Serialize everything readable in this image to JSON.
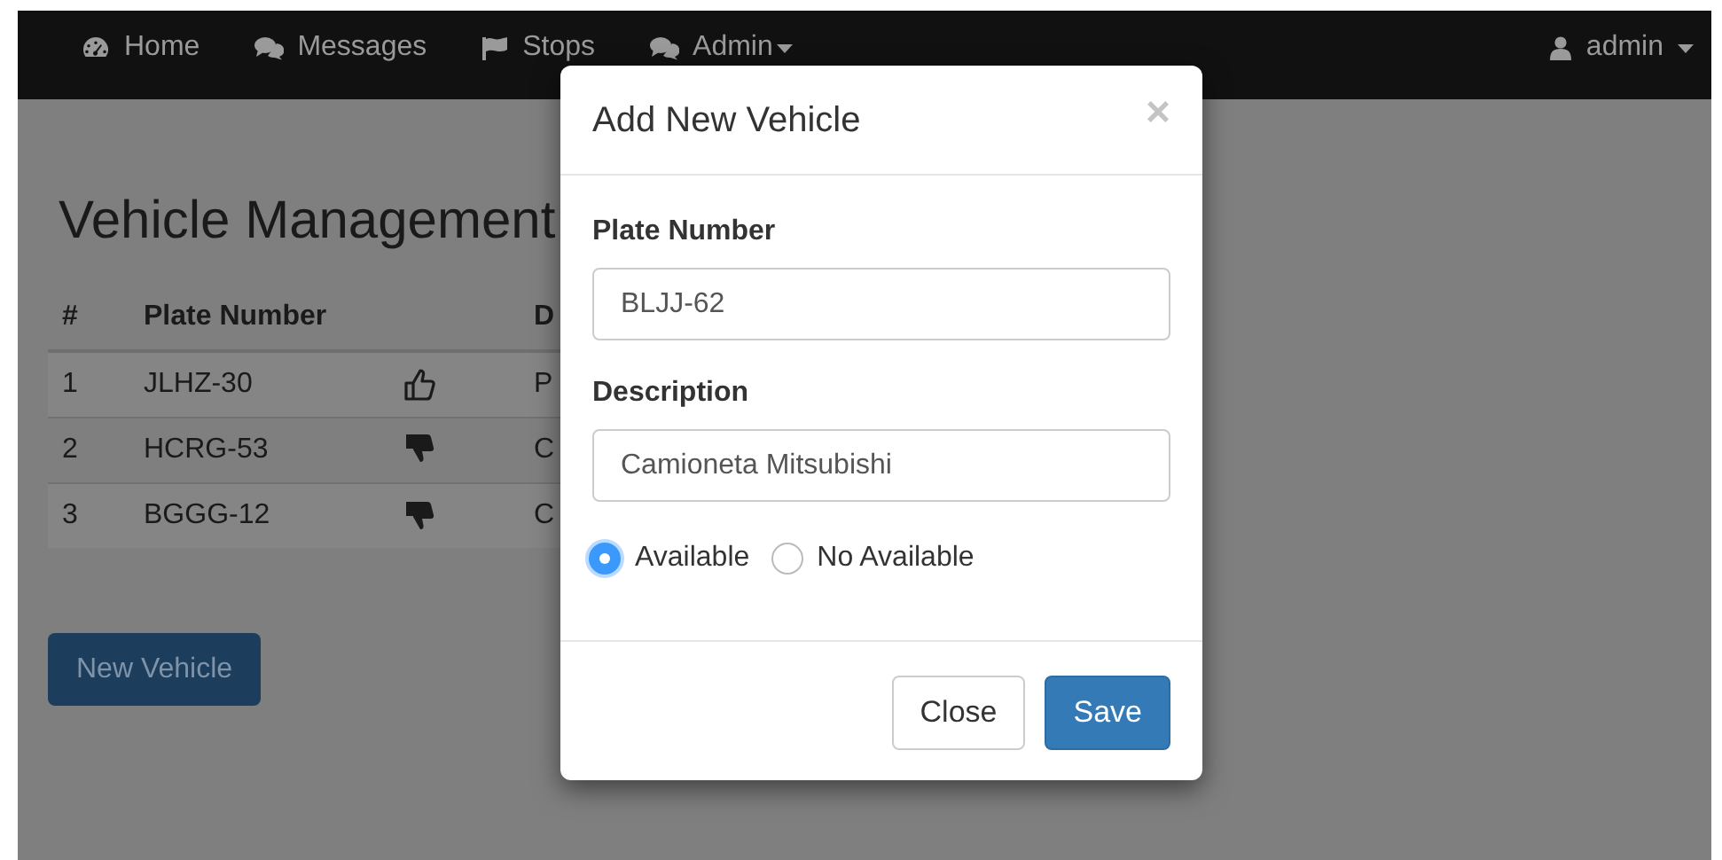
{
  "navbar": {
    "items": [
      {
        "label": "Home",
        "dropdown": false
      },
      {
        "label": "Messages",
        "dropdown": false
      },
      {
        "label": "Stops",
        "dropdown": false
      },
      {
        "label": "Admin",
        "dropdown": true
      }
    ],
    "user": {
      "label": "admin",
      "dropdown": true
    }
  },
  "page": {
    "title": "Vehicle Management",
    "table": {
      "columns": [
        "#",
        "Plate Number",
        "",
        "D"
      ],
      "rows": [
        {
          "cells": [
            "1",
            "JLHZ-30",
            "P"
          ],
          "available": true
        },
        {
          "cells": [
            "2",
            "HCRG-53",
            "C"
          ],
          "available": false
        },
        {
          "cells": [
            "3",
            "BGGG-12",
            "C"
          ],
          "available": false
        }
      ]
    },
    "button": "New Vehicle"
  },
  "modal": {
    "title": "Add New Vehicle",
    "close": "×",
    "fields": [
      {
        "label": "Plate Number",
        "value": "BLJJ-62"
      },
      {
        "label": "Description",
        "value": "Camioneta Mitsubishi"
      }
    ],
    "radios": [
      {
        "label": "Available",
        "selected": true
      },
      {
        "label": "No Available",
        "selected": false
      }
    ],
    "buttons": [
      {
        "label": "Close",
        "kind": "default"
      },
      {
        "label": "Save",
        "kind": "primary"
      }
    ]
  }
}
